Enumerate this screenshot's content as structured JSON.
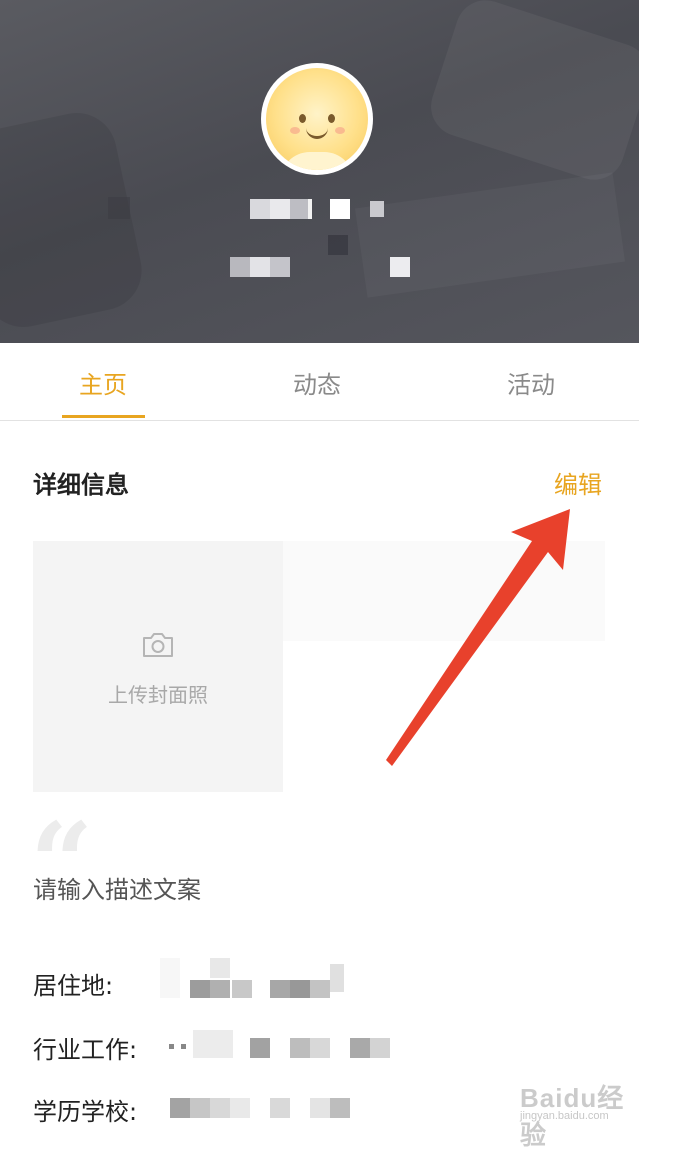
{
  "header": {
    "avatar_alt": "avatar"
  },
  "tabs": [
    {
      "label": "主页",
      "active": true
    },
    {
      "label": "动态",
      "active": false
    },
    {
      "label": "活动",
      "active": false
    }
  ],
  "details": {
    "title": "详细信息",
    "edit_label": "编辑",
    "upload_cover_label": "上传封面照",
    "description_placeholder": "请输入描述文案",
    "fields": [
      {
        "label": "居住地:"
      },
      {
        "label": "行业工作:"
      },
      {
        "label": "学历学校:"
      }
    ]
  },
  "watermark": {
    "text": "Baidu经验",
    "sub": "jingyan.baidu.com"
  },
  "colors": {
    "accent": "#e8a520",
    "annotation_arrow": "#e8412c",
    "header_bg": "#4e4f56"
  }
}
